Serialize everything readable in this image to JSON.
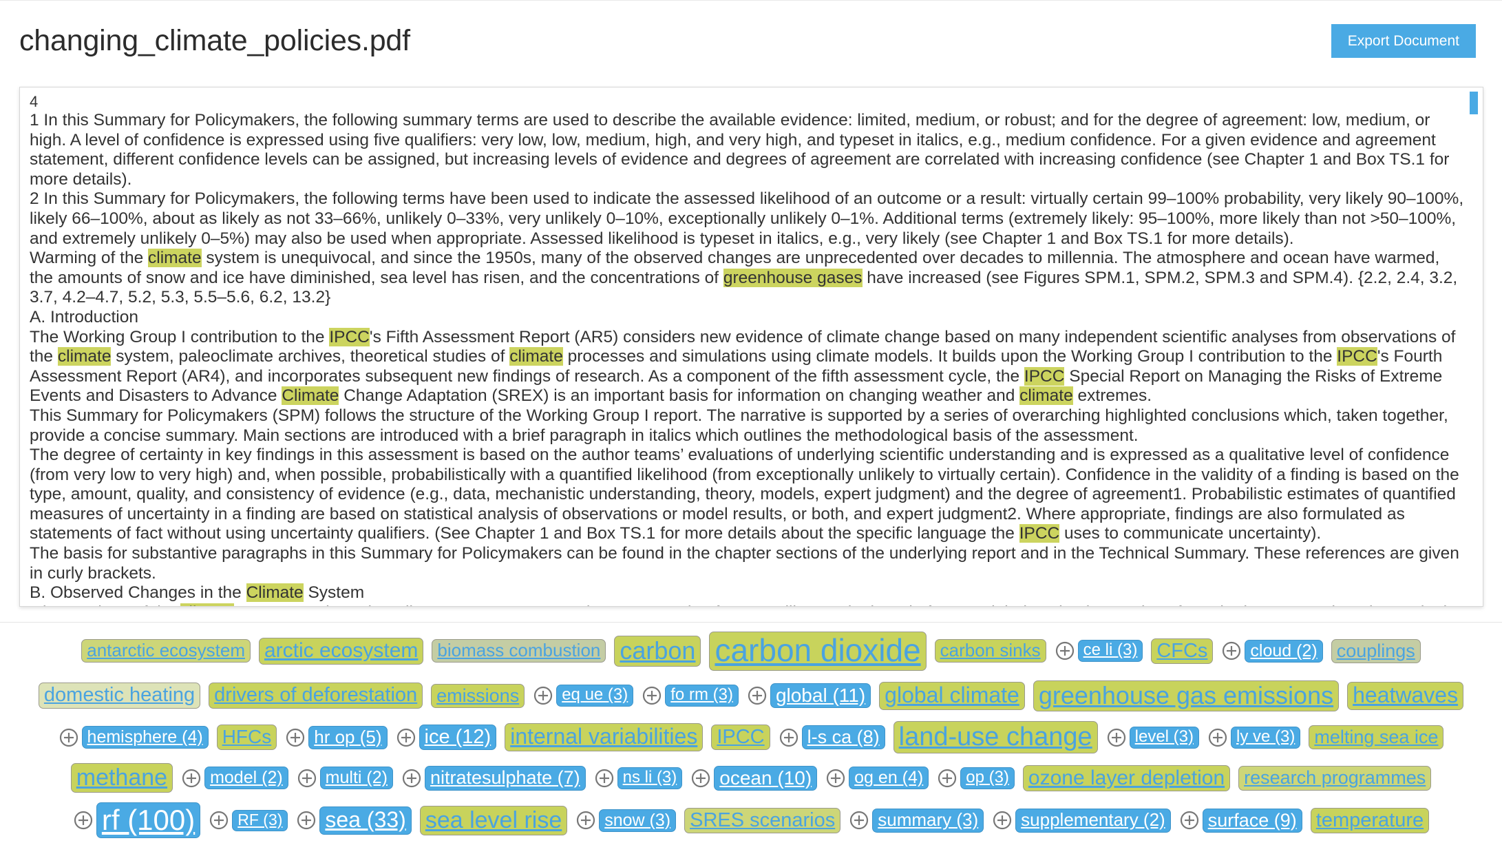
{
  "header": {
    "title": "changing_climate_policies.pdf",
    "export_label": "Export Document"
  },
  "document": {
    "page_number": "4",
    "paragraphs": [
      "1 In this <a>Summary</a> for Policymakers, the following <a>summary</a> terms are used to describe the available evidence: limited, medium, or robust; and for the degree of agreement: low, medium, or high. A <a>level</a> of confidence is expressed using five qualifiers: very low, low, medium, high, and very high, and typeset in italics, e.g., medium confidence. For a given evidence and agreement statement, different confidence <a>levels</a> can be assigned, but increasing <a>levels</a> of evidence and degrees of agreement are correlated with increasing confidence (see Chapter 1 and Box TS.1 for more details).",
      "2 In this <a>Summary</a> for Policymakers, the following terms have been used to indicate the assessed likelihood of an outcome or a result: virtually certain 99–100% probability, very likely 90–100%, likely 66–100%, about as likely as not 33–66%, unlikely 0–33%, very unlikely 0–10%, exceptionally unlikely 0–1%. Additional terms (extremely likely: 95–100%, more likely than not >50–100%, and extremely unlikely 0–5%) may also be used when appropriate. Assessed likelihood is typeset in italics, e.g., very likely (see Chapter 1 and Box TS.1 for more details).",
      "Warming of the <h>climate</h> system is unequivocal, and since the 1950s, many of the observed changes are unprecedented over decades to millennia. The atmosphere and <a>ocean</a> have warmed, the amounts of <a>snow</a> and <a>ice</a> have diminished, <a>sea level</a> has risen, and the concentrations of <h>greenhouse gases</h> have increased (see Figures SPM.1, SPM.2, SPM.3 and SPM.4). {2.2, 2.4, 3.2, 3.7, 4.2–4.7, 5.2, 5.3, 5.5–5.6, 6.2, 13.2}",
      "A. Introduction",
      "The Working Group I contribution to the <h>IPCC</h>'s Fifth Assessment Report (AR5) considers new evidence of climate change based on many independent scientific analyses from observations of the <h>climate</h> system, paleoclimate archives, theoretical studies of <h>climate</h> processes and simulations using climate <a>models</a>. It builds upon the Working Group I contribution to the <h>IPCC</h>'s Fourth Assessment Report (AR4), and incorporates subsequent new findings of research. As a component of the fifth assessment cycle, the <h>IPCC</h> Special Report on Managing the Risks of Extreme Events and Disasters to Advance <h>Climate</h> Change Adaptation (SREX) is an important basis for information on changing weather and <h>climate</h> extremes.",
      "This <a>Summary</a> for Policymakers (SPM) follows the structure of the Working Group I report. The narrative is supported by a series of overarching highlighted conclusions which, taken together, provide a concise <a>summary</a>. Main sections are introduced with a brief paragraph in italics which outlines the methodological basis of the assessment.",
      "The degree of certainty in key findings in this assessment is based on the author teams’ evaluations of underlying scientific understanding and is expressed as a qualitative <a>level</a> of confidence (from very low to very high) and, when possible, probabilistically with a quantified likelihood (from exceptionally unlikely to virtually certain). Confidence in the validity of a finding is based on the type, amount, quality, and consistency of evidence (e.g., data, mechanistic understanding, theory, <a>models</a>, expert judgment) and the degree of agreement1. Probabilistic estimates of quantified measures of uncertainty in a finding are based on statistical analysis of observations or <a>model</a> results, or both, and expert judgment2. Where appropriate, findings are also formulated as statements of fact without using uncertainty qualifiers. (See Chapter 1 and Box TS.1 for more details about the specific language the <h>IPCC</h> uses to communicate uncertainty).",
      "The basis for substantive paragraphs in this <a>Summary</a> for Policymakers can be found in the chapter sections of the underlying report and in the Technical <a>Summary</a>. These references are given in curly brackets.",
      "B. Observed Changes in the <h>Climate</h> System",
      "Observations of the <h>climate</h> system are based on direct measurements and remote sensing from satellites and other platforms. Global-scale observations from the instrumental era began in the mid-19th century for <h>temperature</h> and other variables, with more comprehensive and diverse sets of observations available for the period 1950 onwards. Paleoclimate reconstructions extend some records"
    ]
  },
  "tagcloud": {
    "tags": [
      {
        "label": "antarctic ecosystem",
        "size": 26,
        "style": "mid",
        "selected": false,
        "has_plus": false
      },
      {
        "label": "arctic ecosystem",
        "size": 30,
        "style": "normal",
        "selected": false,
        "has_plus": false
      },
      {
        "label": "biomass combustion",
        "size": 26,
        "style": "pale",
        "selected": false,
        "has_plus": false
      },
      {
        "label": "carbon",
        "size": 36,
        "style": "normal",
        "selected": false,
        "has_plus": false
      },
      {
        "label": "carbon dioxide",
        "size": 46,
        "style": "normal",
        "selected": false,
        "has_plus": false
      },
      {
        "label": "carbon sinks",
        "size": 26,
        "style": "normal",
        "selected": false,
        "has_plus": false
      },
      {
        "label": "ce li (3)",
        "size": 24,
        "style": "normal",
        "selected": true,
        "has_plus": true
      },
      {
        "label": "CFCs",
        "size": 29,
        "style": "normal",
        "selected": false,
        "has_plus": false
      },
      {
        "label": "cloud (2)",
        "size": 25,
        "style": "normal",
        "selected": true,
        "has_plus": true
      },
      {
        "label": "couplings",
        "size": 27,
        "style": "pale",
        "selected": false,
        "has_plus": false
      },
      {
        "label": "domestic heating",
        "size": 29,
        "style": "paler",
        "selected": false,
        "has_plus": false
      },
      {
        "label": "drivers of deforestation",
        "size": 29,
        "style": "normal",
        "selected": false,
        "has_plus": false
      },
      {
        "label": "emissions",
        "size": 27,
        "style": "normal",
        "selected": false,
        "has_plus": false
      },
      {
        "label": "eq ue (3)",
        "size": 24,
        "style": "normal",
        "selected": true,
        "has_plus": true
      },
      {
        "label": "fo rm (3)",
        "size": 24,
        "style": "normal",
        "selected": true,
        "has_plus": true
      },
      {
        "label": "global (11)",
        "size": 28,
        "style": "normal",
        "selected": true,
        "has_plus": true
      },
      {
        "label": "global climate",
        "size": 32,
        "style": "normal",
        "selected": false,
        "has_plus": false
      },
      {
        "label": "greenhouse gas emissions",
        "size": 36,
        "style": "normal",
        "selected": false,
        "has_plus": false
      },
      {
        "label": "heatwaves",
        "size": 32,
        "style": "normal",
        "selected": false,
        "has_plus": false
      },
      {
        "label": "hemisphere (4)",
        "size": 25,
        "style": "normal",
        "selected": true,
        "has_plus": true
      },
      {
        "label": "HFCs",
        "size": 28,
        "style": "normal",
        "selected": false,
        "has_plus": false
      },
      {
        "label": "hr op (5)",
        "size": 26,
        "style": "normal",
        "selected": true,
        "has_plus": true
      },
      {
        "label": "ice (12)",
        "size": 29,
        "style": "normal",
        "selected": true,
        "has_plus": true
      },
      {
        "label": "internal variabilities",
        "size": 32,
        "style": "normal",
        "selected": false,
        "has_plus": false
      },
      {
        "label": "IPCC",
        "size": 29,
        "style": "normal",
        "selected": false,
        "has_plus": false
      },
      {
        "label": "l-s ca (8)",
        "size": 27,
        "style": "normal",
        "selected": true,
        "has_plus": true
      },
      {
        "label": "land-use change",
        "size": 38,
        "style": "normal",
        "selected": false,
        "has_plus": false
      },
      {
        "label": "level (3)",
        "size": 24,
        "style": "normal",
        "selected": true,
        "has_plus": true
      },
      {
        "label": "ly ve (3)",
        "size": 24,
        "style": "normal",
        "selected": true,
        "has_plus": true
      },
      {
        "label": "melting sea ice",
        "size": 27,
        "style": "normal",
        "selected": false,
        "has_plus": false
      },
      {
        "label": "methane",
        "size": 34,
        "style": "normal",
        "selected": false,
        "has_plus": false
      },
      {
        "label": "model (2)",
        "size": 25,
        "style": "normal",
        "selected": true,
        "has_plus": true
      },
      {
        "label": "multi (2)",
        "size": 25,
        "style": "normal",
        "selected": true,
        "has_plus": true
      },
      {
        "label": "nitratesulphate (7)",
        "size": 27,
        "style": "normal",
        "selected": true,
        "has_plus": true
      },
      {
        "label": "ns li (3)",
        "size": 24,
        "style": "normal",
        "selected": true,
        "has_plus": true
      },
      {
        "label": "ocean (10)",
        "size": 28,
        "style": "normal",
        "selected": true,
        "has_plus": true
      },
      {
        "label": "og en (4)",
        "size": 25,
        "style": "normal",
        "selected": true,
        "has_plus": true
      },
      {
        "label": "op (3)",
        "size": 24,
        "style": "normal",
        "selected": true,
        "has_plus": true
      },
      {
        "label": "ozone layer depletion",
        "size": 30,
        "style": "normal",
        "selected": false,
        "has_plus": false
      },
      {
        "label": "research programmes",
        "size": 27,
        "style": "mid",
        "selected": false,
        "has_plus": false
      },
      {
        "label": "rf (100)",
        "size": 42,
        "style": "normal",
        "selected": true,
        "has_plus": true
      },
      {
        "label": "RF (3)",
        "size": 23,
        "style": "normal",
        "selected": true,
        "has_plus": true
      },
      {
        "label": "sea (33)",
        "size": 32,
        "style": "normal",
        "selected": true,
        "has_plus": true
      },
      {
        "label": "sea level rise",
        "size": 34,
        "style": "normal",
        "selected": false,
        "has_plus": false
      },
      {
        "label": "snow (3)",
        "size": 25,
        "style": "normal",
        "selected": true,
        "has_plus": true
      },
      {
        "label": "SRES scenarios",
        "size": 29,
        "style": "mid",
        "selected": false,
        "has_plus": false
      },
      {
        "label": "summary (3)",
        "size": 26,
        "style": "normal",
        "selected": true,
        "has_plus": true
      },
      {
        "label": "supplementary (2)",
        "size": 26,
        "style": "normal",
        "selected": true,
        "has_plus": true
      },
      {
        "label": "surface (9)",
        "size": 27,
        "style": "normal",
        "selected": true,
        "has_plus": true
      },
      {
        "label": "temperature",
        "size": 29,
        "style": "normal",
        "selected": false,
        "has_plus": false
      }
    ]
  },
  "colors": {
    "accent_blue": "#4aaae4",
    "link_blue": "#4aa3e0",
    "highlight_green": "#ccd45f",
    "tag_green": "#c8d35c"
  }
}
